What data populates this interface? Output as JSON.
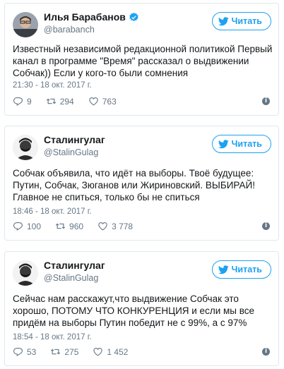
{
  "tweets": [
    {
      "name": "Илья Барабанов",
      "verified": true,
      "handle": "@barabanch",
      "follow_label": "Читать",
      "text": "Известный независимой редакционной политикой Первый канал в программе \"Время\" рассказал о выдвижении Собчак)) Если у кого-то были сомнения",
      "time": "21:30 - 18 окт. 2017 г.",
      "replies": "9",
      "retweets": "294",
      "likes": "763"
    },
    {
      "name": "Сталингулаг",
      "verified": false,
      "handle": "@StalinGulag",
      "follow_label": "Читать",
      "text": "Собчак объявила, что идёт на выборы. Твоё будущее: Путин, Собчак, Зюганов или Жириновский. ВЫБИРАЙ! Главное не спиться, только бы не спиться",
      "time": "18:46 - 18 окт. 2017 г.",
      "replies": "100",
      "retweets": "960",
      "likes": "3 778"
    },
    {
      "name": "Сталингулаг",
      "verified": false,
      "handle": "@StalinGulag",
      "follow_label": "Читать",
      "text": "Сейчас нам расскажут,что выдвижение Собчак это хорошо, ПОТОМУ ЧТО КОНКУРЕНЦИЯ и если мы все придём на выборы Путин победит не с 99%, а с 97%",
      "time": "18:54 - 18 окт. 2017 г.",
      "replies": "53",
      "retweets": "275",
      "likes": "1 452"
    }
  ],
  "icons": {
    "bird": "twitter-bird-icon",
    "verified": "verified-badge-icon",
    "reply": "reply-icon",
    "retweet": "retweet-icon",
    "like": "heart-icon",
    "info": "info-icon"
  },
  "colors": {
    "accent": "#1da1f2",
    "muted": "#657786",
    "border": "#e1e8ed"
  }
}
